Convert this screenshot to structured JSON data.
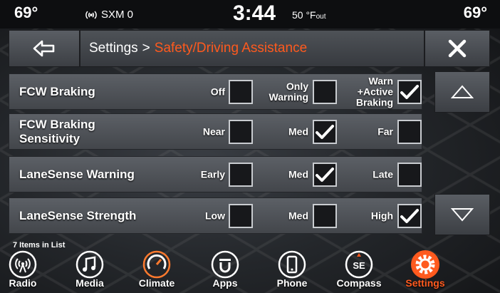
{
  "status": {
    "temp_left": "69°",
    "radio": "SXM 0",
    "clock": "3:44",
    "outside_temp": "50 °F",
    "outside_suffix": "out",
    "temp_right": "69°"
  },
  "header": {
    "crumb_root": "Settings",
    "crumb_sep": ">",
    "crumb_current": "Safety/Driving Assistance",
    "accent_color": "#ff5a1e"
  },
  "rows": [
    {
      "label_lines": [
        "FCW Braking"
      ],
      "options": [
        {
          "label_lines": [
            "Off"
          ],
          "checked": false
        },
        {
          "label_lines": [
            "Only",
            "Warning"
          ],
          "checked": false
        },
        {
          "label_lines": [
            "Warn",
            "+Active",
            "Braking"
          ],
          "checked": true
        }
      ]
    },
    {
      "label_lines": [
        "FCW Braking",
        "Sensitivity"
      ],
      "options": [
        {
          "label_lines": [
            "Near"
          ],
          "checked": false
        },
        {
          "label_lines": [
            "Med"
          ],
          "checked": true
        },
        {
          "label_lines": [
            "Far"
          ],
          "checked": false
        }
      ]
    },
    {
      "label_lines": [
        "LaneSense Warning"
      ],
      "options": [
        {
          "label_lines": [
            "Early"
          ],
          "checked": false
        },
        {
          "label_lines": [
            "Med"
          ],
          "checked": true
        },
        {
          "label_lines": [
            "Late"
          ],
          "checked": false
        }
      ]
    },
    {
      "label_lines": [
        "LaneSense Strength"
      ],
      "options": [
        {
          "label_lines": [
            "Low"
          ],
          "checked": false
        },
        {
          "label_lines": [
            "Med"
          ],
          "checked": false
        },
        {
          "label_lines": [
            "High"
          ],
          "checked": true
        }
      ]
    }
  ],
  "list_count": "7 Items in List",
  "nav": [
    {
      "label": "Radio",
      "icon": "radio-icon",
      "active": false
    },
    {
      "label": "Media",
      "icon": "music-note-icon",
      "active": false
    },
    {
      "label": "Climate",
      "icon": "climate-icon",
      "active": false
    },
    {
      "label": "Apps",
      "icon": "apps-icon",
      "active": false
    },
    {
      "label": "Phone",
      "icon": "phone-icon",
      "active": false
    },
    {
      "label": "Compass",
      "icon": "compass-icon",
      "compass_heading": "SE",
      "active": false
    },
    {
      "label": "Settings",
      "icon": "settings-gear-icon",
      "active": true
    }
  ]
}
